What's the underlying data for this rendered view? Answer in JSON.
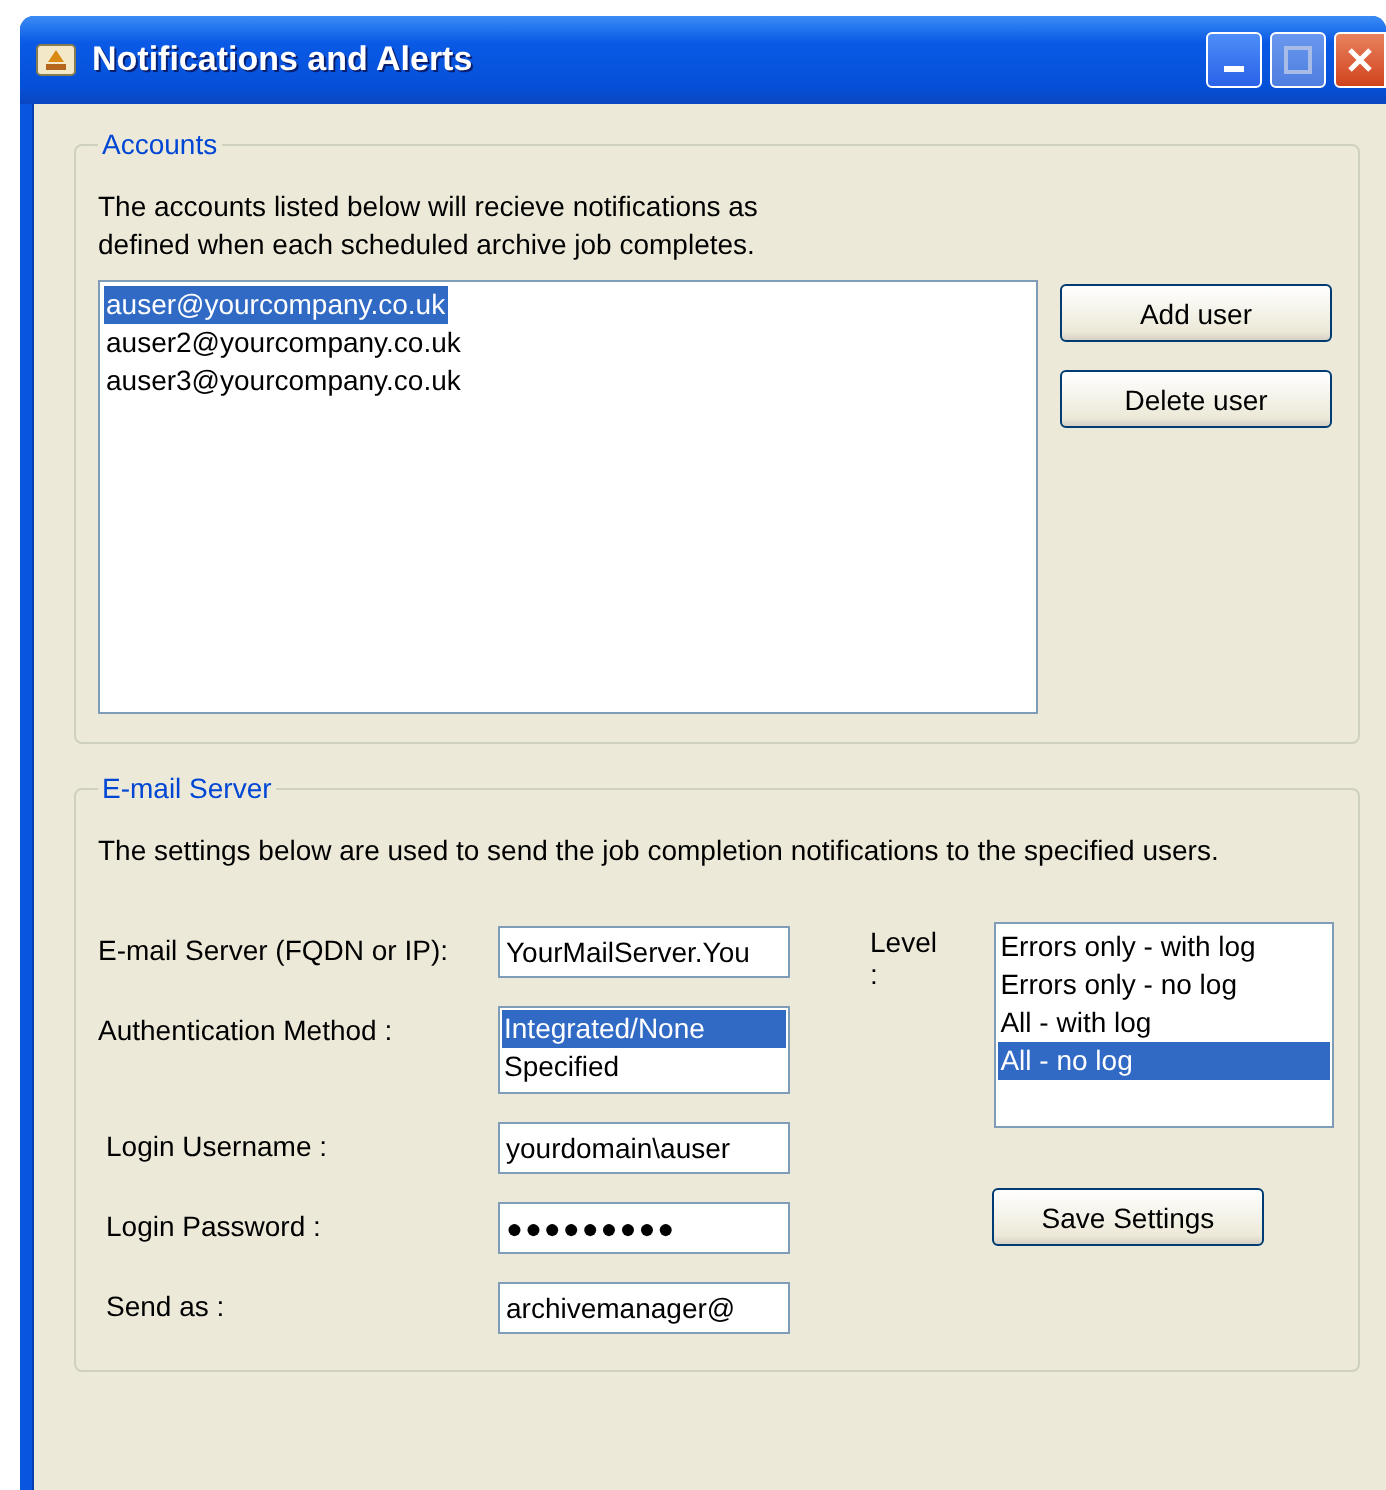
{
  "window": {
    "title": "Notifications and Alerts"
  },
  "accounts": {
    "legend": "Accounts",
    "description": "The accounts listed below will recieve notifications as\ndefined when each scheduled archive job completes.",
    "users": [
      {
        "text": "auser@yourcompany.co.uk",
        "selected": true
      },
      {
        "text": "auser2@yourcompany.co.uk",
        "selected": false
      },
      {
        "text": "auser3@yourcompany.co.uk",
        "selected": false
      }
    ],
    "buttons": [
      "Add user",
      "Delete user"
    ]
  },
  "email_server": {
    "legend": "E-mail Server",
    "description": "The settings below are used to send the job completion notifications to the specified users.",
    "fields": [
      {
        "kind": "text",
        "label": "E-mail Server (FQDN or IP):",
        "value": "YourMailServer.You"
      },
      {
        "kind": "list",
        "label": "Authentication Method :",
        "options": [
          {
            "text": "Integrated/None",
            "selected": true
          },
          {
            "text": "Specified",
            "selected": false
          }
        ]
      },
      {
        "kind": "text",
        "label": "Login Username :",
        "value": "yourdomain\\auser"
      },
      {
        "kind": "password",
        "label": "Login Password :",
        "value": "●●●●●●●●●"
      },
      {
        "kind": "text",
        "label": "Send as :",
        "value": "archivemanager@"
      }
    ],
    "level": {
      "label": "Level :",
      "options": [
        {
          "text": "Errors only - with log",
          "selected": false
        },
        {
          "text": "Errors only - no log",
          "selected": false
        },
        {
          "text": "All - with log",
          "selected": false
        },
        {
          "text": "All - no log",
          "selected": true
        }
      ]
    },
    "save_button": "Save Settings"
  }
}
